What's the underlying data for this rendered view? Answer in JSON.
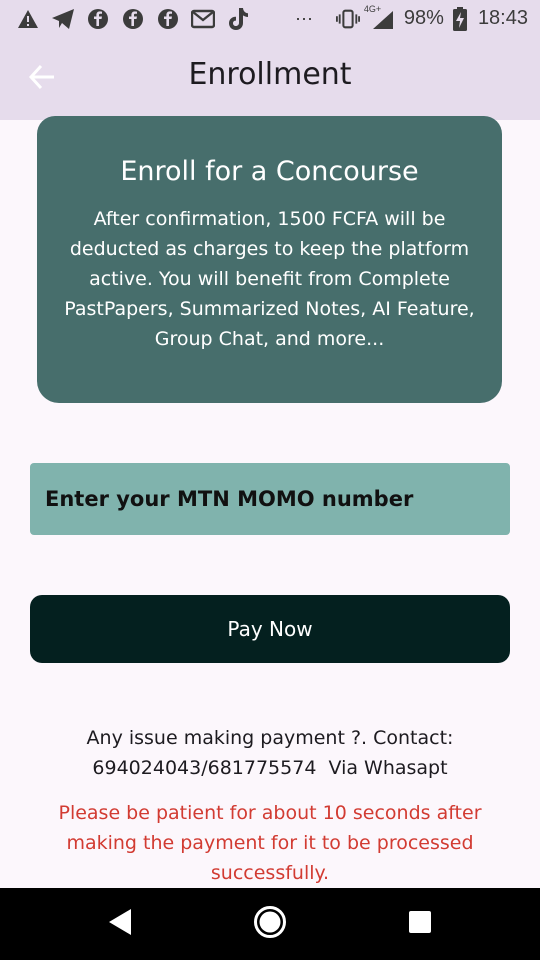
{
  "status_bar": {
    "notification_icons": [
      "warning-icon",
      "telegram-icon",
      "facebook-icon",
      "facebook-icon",
      "facebook-icon",
      "email-icon",
      "tiktok-icon"
    ],
    "overflow": "⋯",
    "network": "4G+",
    "battery": "98%",
    "time": "18:43"
  },
  "app_bar": {
    "title": "Enrollment"
  },
  "card": {
    "title": "Enroll for a Concourse",
    "body": "After confirmation, 1500 FCFA will be deducted as charges to keep the platform active. You will benefit from Complete PastPapers, Summarized Notes, AI Feature, Group Chat, and more..."
  },
  "momo_input": {
    "placeholder": "Enter your MTN MOMO number",
    "value": ""
  },
  "pay_button": {
    "label": "Pay Now"
  },
  "contact": {
    "line1": "Any issue making payment ?. Contact:",
    "line2": "694024043/681775574  Via Whasapt"
  },
  "notice": "Please be patient for about 10 seconds after making the payment for it to be processed successfully.",
  "colors": {
    "app_bar_bg": "#e6dcec",
    "page_bg": "#fcf7fc",
    "card_bg": "#476e6c",
    "input_bg": "#80b3ad",
    "button_bg": "#04201f",
    "notice_text": "#d23b32"
  }
}
